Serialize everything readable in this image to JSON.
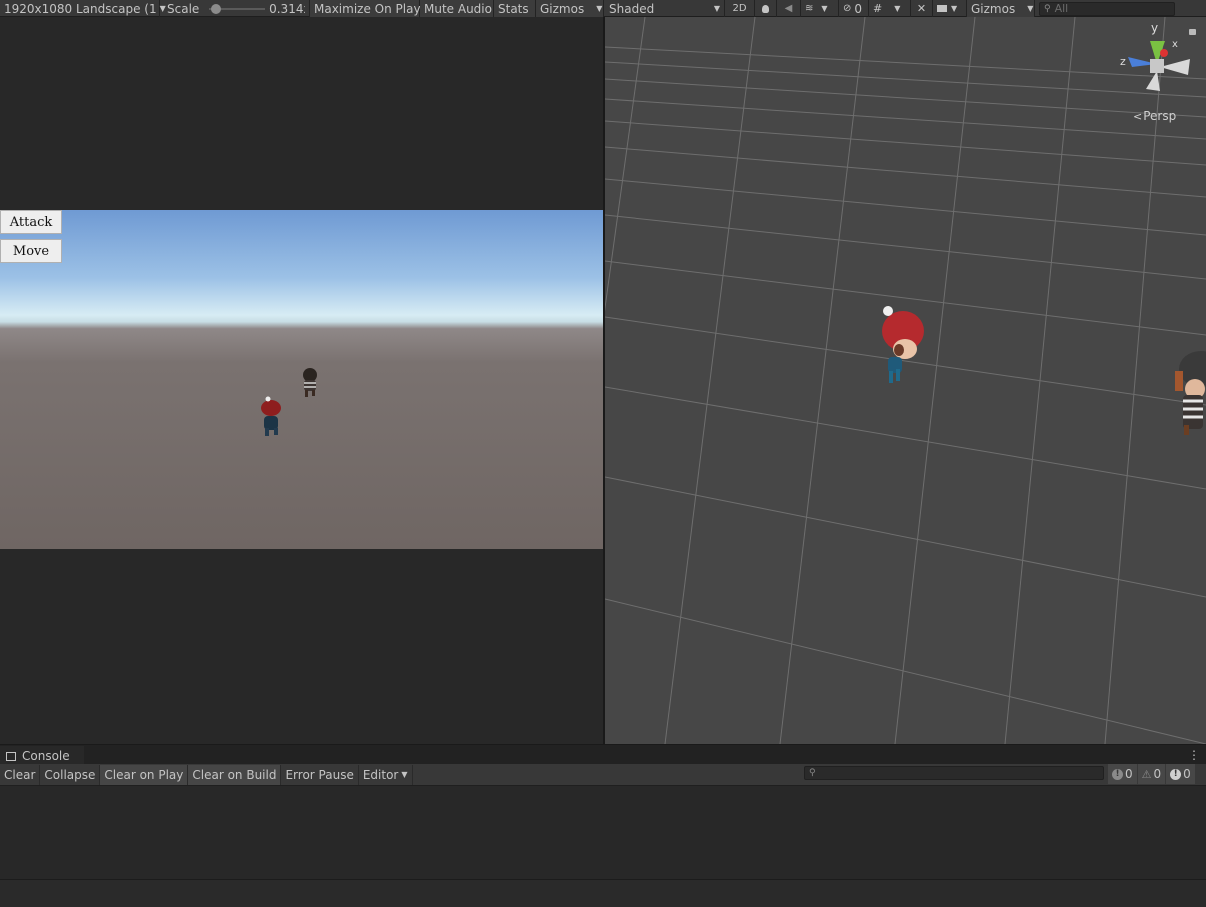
{
  "game_toolbar": {
    "resolution": "1920x1080 Landscape (1",
    "scale_label": "Scale",
    "scale_value": "0.314x",
    "scale_fraction": 0.05,
    "maximize": "Maximize On Play",
    "mute": "Mute Audio",
    "stats": "Stats",
    "gizmos": "Gizmos"
  },
  "scene_toolbar": {
    "shading": "Shaded",
    "mode_2d": "2D",
    "hidden_count": "0",
    "gizmos": "Gizmos",
    "search_placeholder": "All"
  },
  "game_gui": {
    "attack_label": "Attack",
    "move_label": "Move"
  },
  "scene_gizmo": {
    "y_label": "y",
    "x_label": "x",
    "z_label": "z",
    "projection": "Persp"
  },
  "console": {
    "tab_label": "Console",
    "clear": "Clear",
    "collapse": "Collapse",
    "clear_on_play": "Clear on Play",
    "clear_on_build": "Clear on Build",
    "error_pause": "Error Pause",
    "editor": "Editor",
    "log_count": "0",
    "warning_count": "0",
    "error_count": "0"
  },
  "colors": {
    "editor_bg": "#282828",
    "toolbar_bg": "#383838",
    "scene_bg": "#474747",
    "grid_line": "#6e6e6e"
  }
}
